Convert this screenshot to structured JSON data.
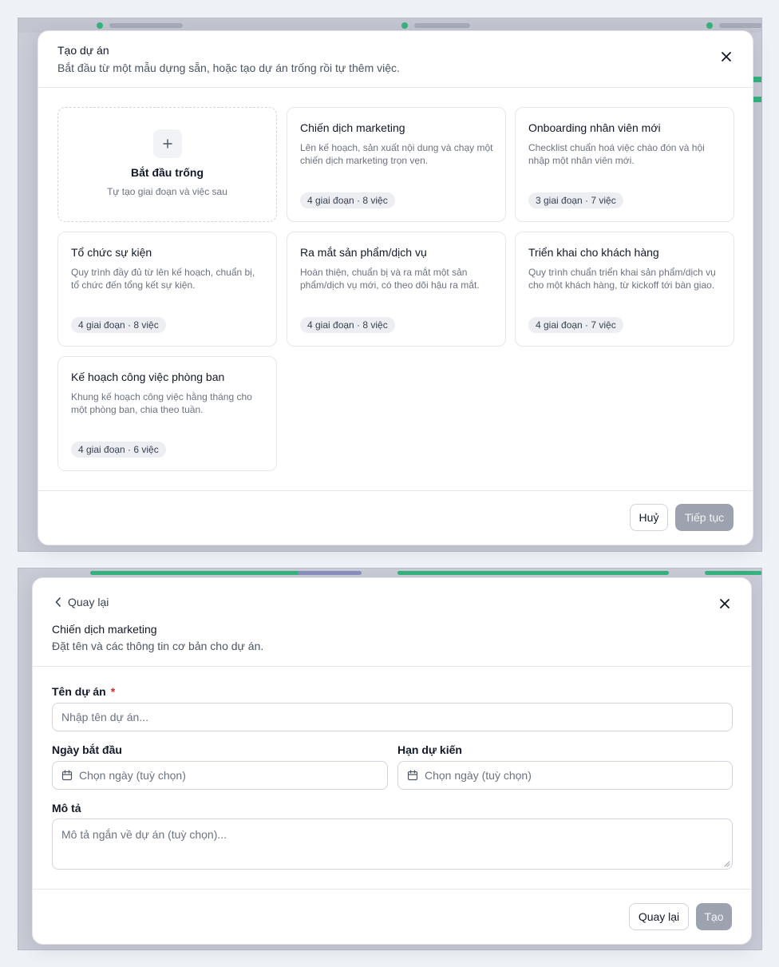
{
  "template_picker": {
    "title": "Tạo dự án",
    "subtitle": "Bắt đầu từ một mẫu dựng sẵn, hoặc tạo dự án trống rồi tự thêm việc.",
    "blank": {
      "title": "Bắt đầu trống",
      "subtitle": "Tự tạo giai đoạn và việc sau"
    },
    "templates": [
      {
        "title": "Chiến dịch marketing",
        "description": "Lên kế hoạch, sản xuất nội dung và chạy một chiến dịch marketing trọn vẹn.",
        "badge": "4 giai đoạn · 8 việc"
      },
      {
        "title": "Onboarding nhân viên mới",
        "description": "Checklist chuẩn hoá việc chào đón và hội nhập một nhân viên mới.",
        "badge": "3 giai đoạn · 7 việc"
      },
      {
        "title": "Tổ chức sự kiện",
        "description": "Quy trình đầy đủ từ lên kế hoạch, chuẩn bị, tổ chức đến tổng kết sự kiện.",
        "badge": "4 giai đoạn · 8 việc"
      },
      {
        "title": "Ra mắt sản phẩm/dịch vụ",
        "description": "Hoàn thiện, chuẩn bị và ra mắt một sản phẩm/dịch vụ mới, có theo dõi hậu ra mắt.",
        "badge": "4 giai đoạn · 8 việc"
      },
      {
        "title": "Triển khai cho khách hàng",
        "description": "Quy trình chuẩn triển khai sản phẩm/dịch vụ cho một khách hàng, từ kickoff tới bàn giao.",
        "badge": "4 giai đoạn · 7 việc"
      },
      {
        "title": "Kế hoạch công việc phòng ban",
        "description": "Khung kế hoạch công việc hằng tháng cho một phòng ban, chia theo tuần.",
        "badge": "4 giai đoạn · 6 việc"
      }
    ],
    "cancel_label": "Huỷ",
    "continue_label": "Tiếp tục"
  },
  "project_form": {
    "back_label": "Quay lại",
    "title": "Chiến dịch marketing",
    "subtitle": "Đặt tên và các thông tin cơ bản cho dự án.",
    "name_label": "Tên dự án",
    "required_mark": "*",
    "name_placeholder": "Nhập tên dự án...",
    "start_label": "Ngày bắt đầu",
    "start_placeholder": "Chọn ngày (tuỳ chọn)",
    "due_label": "Hạn dự kiến",
    "due_placeholder": "Chọn ngày (tuỳ chọn)",
    "desc_label": "Mô tả",
    "desc_placeholder": "Mô tả ngắn về dự án (tuỳ chọn)...",
    "back_button_label": "Quay lại",
    "create_label": "Tạo"
  },
  "colors": {
    "accent_green": "#34b37e",
    "disabled_button": "#9ca3af",
    "required": "#dc2626"
  },
  "icons": [
    "plus-icon",
    "close-icon",
    "chevron-left-icon",
    "calendar-icon"
  ]
}
